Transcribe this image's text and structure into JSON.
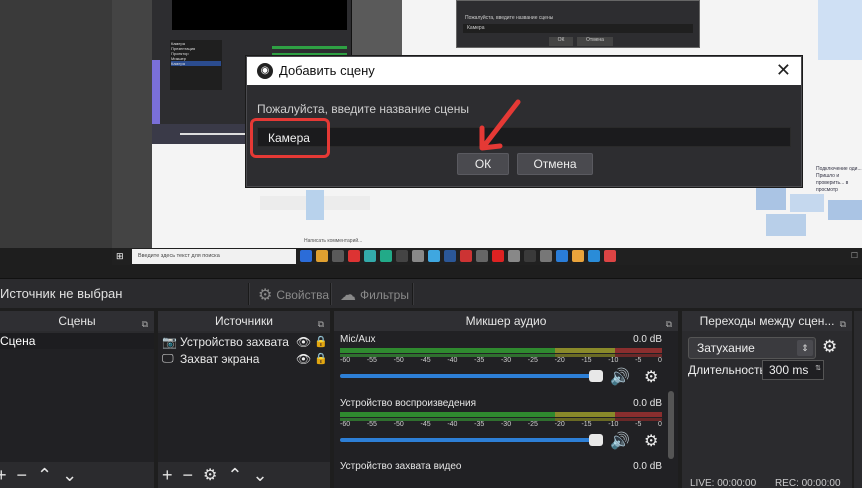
{
  "preview": {
    "mini_obs": {
      "scene_list": [
        "Камера",
        "Презентация",
        "Проектор",
        "Микшер",
        "Камера"
      ],
      "selected_index": 4
    },
    "mini_dialog": {
      "prompt": "Пожалуйста, введите название сцены",
      "input_value": "Камера",
      "ok": "ОК",
      "cancel": "Отмена"
    },
    "taskbar": {
      "search_placeholder": "Введите здесь текст для поиска",
      "chat_hint": "Написать комментарий...",
      "icon_colors": [
        "#2b6cd8",
        "#e0a030",
        "#5a5a5a",
        "#d33",
        "#3aa",
        "#2a8",
        "#444",
        "#888",
        "#3fa7e0",
        "#2b5797",
        "#c33",
        "#666",
        "#d22",
        "#888",
        "#3a3a3a",
        "#777",
        "#2a7dd8",
        "#e9a33b",
        "#2a8cd8",
        "#d44"
      ]
    },
    "right_text": "Подключение оди... Пришло и проверить... в просмотр"
  },
  "context_bar": {
    "no_source": "Источник не выбран",
    "properties": "Свойства",
    "filters": "Фильтры"
  },
  "docks": {
    "scenes": {
      "title": "Сцены",
      "items": [
        "Сцена"
      ]
    },
    "sources": {
      "title": "Источники",
      "items": [
        {
          "label": "Устройство захвата",
          "icon": "camera-icon"
        },
        {
          "label": "Захват экрана",
          "icon": "monitor-icon"
        }
      ]
    },
    "mixer": {
      "title": "Микшер аудио",
      "channels": [
        {
          "name": "Mic/Aux",
          "db": "0.0 dB",
          "level": 0.87
        },
        {
          "name": "Устройство воспроизведения",
          "db": "0.0 dB",
          "level": 0.87
        },
        {
          "name": "Устройство захвата видео",
          "db": "0.0 dB",
          "level": 0.87
        }
      ],
      "ticks": [
        "-60",
        "-55",
        "-50",
        "-45",
        "-40",
        "-35",
        "-30",
        "-25",
        "-20",
        "-15",
        "-10",
        "-5",
        "0"
      ]
    },
    "transitions": {
      "title": "Переходы между сцен...",
      "selected": "Затухание",
      "duration_label": "Длительность",
      "duration_value": "300 ms"
    }
  },
  "status": {
    "live": "LIVE: 00:00:00",
    "rec": "REC: 00:00:00"
  },
  "dialog": {
    "title": "Добавить сцену",
    "prompt": "Пожалуйста, введите название сцены",
    "input_value": "Камера",
    "ok": "ОК",
    "cancel": "Отмена"
  },
  "colors": {
    "highlight": "#e53935",
    "accent_blue": "#2d7fd6"
  }
}
